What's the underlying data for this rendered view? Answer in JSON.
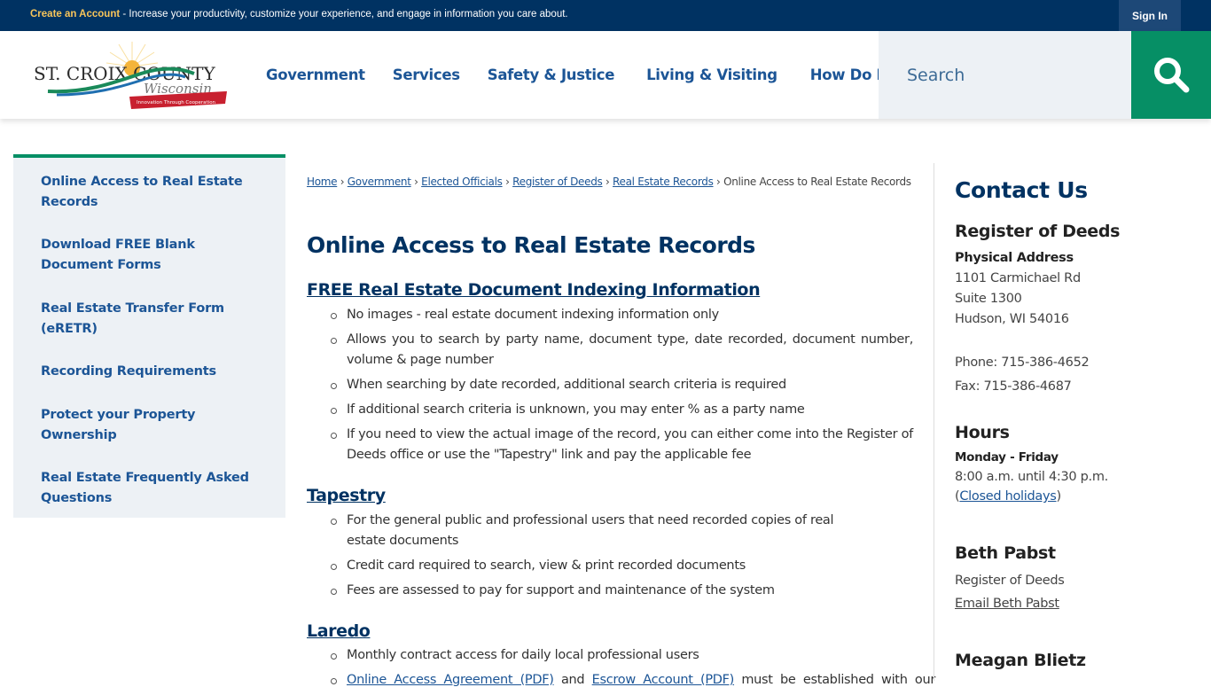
{
  "topbar": {
    "create_account": "Create an Account",
    "message": " - Increase your productivity, customize your experience, and engage in information you care about.",
    "sign_in": "Sign In"
  },
  "header": {
    "logo_alt": "St. Croix County Wisconsin - Innovation Through Cooperation",
    "logo_line1": "ST. CROIX COUNTY",
    "logo_line2": "Wisconsin",
    "logo_tagline": "Innovation Through Cooperation",
    "nav": [
      "Government",
      "Services",
      "Safety & Justice",
      "Living & Visiting",
      "How Do I..."
    ],
    "search_placeholder": "Search",
    "search_icon": "search-icon"
  },
  "colors": {
    "topbar": "#003262",
    "nav_link": "#1c5596",
    "accent_green": "#068f65",
    "sidebar_bg": "#edf1f5",
    "heading": "#003262"
  },
  "sidebar": {
    "items": [
      "Online Access to Real Estate Records",
      "Download FREE Blank Document Forms",
      "Real Estate Transfer Form (eRETR)",
      "Recording Requirements",
      "Protect your Property Ownership",
      "Real Estate Frequently Asked Questions"
    ]
  },
  "breadcrumb": {
    "links": [
      "Home",
      "Government",
      "Elected Officials",
      "Register of Deeds",
      "Real Estate Records"
    ],
    "current": "Online Access to Real Estate Records",
    "separator": "›"
  },
  "main": {
    "title": "Online Access to Real Estate Records",
    "sections": [
      {
        "title": "FREE Real Estate Document Indexing Information",
        "bullets": [
          "No images - real estate document indexing information only",
          "Allows you to search by party name, document type, date recorded, document number, volume & page number",
          "When searching by date recorded, additional search criteria is required",
          "If additional search criteria is unknown, you may enter % as a party name",
          "If you need to view the actual image of the record, you can either come into the Register of Deeds office or use the \"Tapestry\" link and pay the applicable fee"
        ]
      },
      {
        "title": "Tapestry",
        "bullets": [
          "For the general public and professional users that need recorded copies of real estate documents",
          "Credit card required to search, view & print recorded documents",
          "Fees are assessed to pay for support and maintenance of the system"
        ]
      },
      {
        "title": "Laredo",
        "bullets": [
          "Monthly contract access for daily local professional users"
        ],
        "partial_bullet": {
          "link1": "Online Access Agreement (PDF)",
          "mid": " and ",
          "link2": "Escrow Account (PDF)",
          "rest": " must be established with our"
        }
      }
    ]
  },
  "contact": {
    "title": "Contact Us",
    "dept": "Register of Deeds",
    "address_label": "Physical Address",
    "address": [
      "1101 Carmichael Rd",
      "Suite 1300",
      "Hudson, WI 54016"
    ],
    "phone": "Phone: 715-386-4652",
    "fax": "Fax: 715-386-4687",
    "hours_title": "Hours",
    "hours_days": "Monday - Friday",
    "hours_time": "8:00 a.m. until 4:30 p.m.",
    "holidays_open": "(",
    "holidays_link": "Closed holidays",
    "holidays_close": ")",
    "people": [
      {
        "name": "Beth Pabst",
        "role": "Register of Deeds",
        "email_label": "Email Beth Pabst"
      },
      {
        "name": "Meagan Blietz"
      }
    ]
  }
}
